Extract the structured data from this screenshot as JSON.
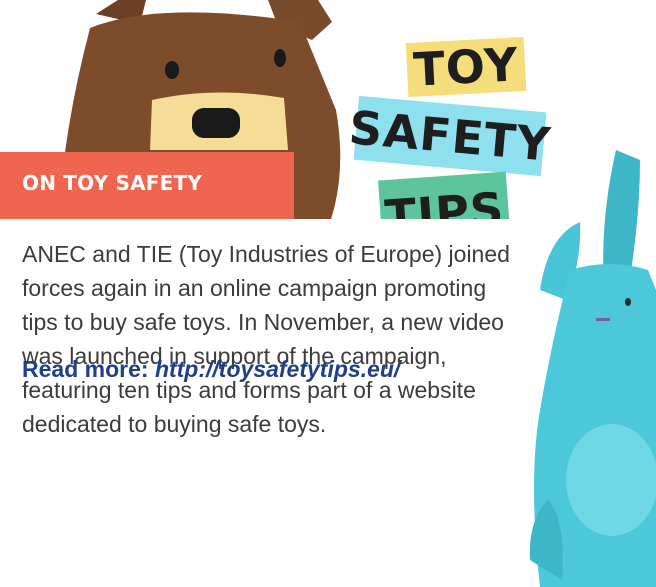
{
  "hero": {
    "bear_icon": "teddy-bear-illustration",
    "bunny_icon": "bunny-plush-illustration",
    "signs": {
      "toy": "TOY",
      "safety": "SAFETY",
      "tips": "TIPS"
    },
    "colors": {
      "bear": "#7a4b2a",
      "bear_muzzle": "#f5dd97",
      "bunny": "#4cc8da",
      "sign_toy": "#f5dd7c",
      "sign_safety": "#8fe0ee",
      "sign_tips": "#5ec49c"
    }
  },
  "banner": {
    "title": "ON TOY SAFETY",
    "color": "#ef6550"
  },
  "article": {
    "body": "ANEC and TIE (Toy Industries of Europe) joined forces again in an online campaign promoting tips to buy safe toys. In November, a new video was launched in support of the campaign, featuring ten tips and forms part of a website dedicated to buying safe toys.",
    "read_more_label": "Read more: ",
    "read_more_url": "http://toysafetytips.eu/",
    "link_color": "#1f3f8a"
  }
}
